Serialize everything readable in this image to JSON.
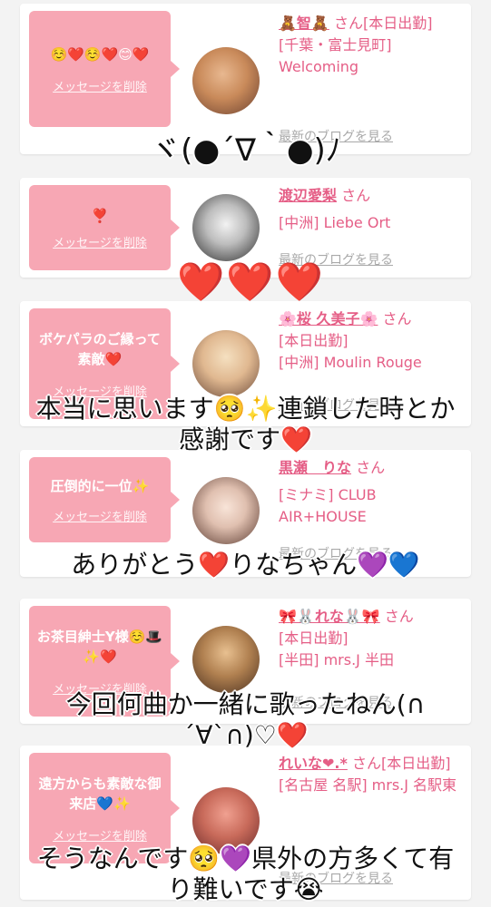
{
  "cards": [
    {
      "message": "☺️❤️☺️❤️😊❤️",
      "delete_label": "メッセージを削除",
      "name": "🧸智🧸",
      "suffix": "さん[本日出勤]",
      "location": "[千葉・富士見町] Welcoming",
      "location2": "",
      "blog_label": "最新のブログを見る",
      "avatar_colors": [
        "#c98a5a",
        "#8a5a3a"
      ]
    },
    {
      "message": "❣️",
      "delete_label": "メッセージを削除",
      "name": "渡辺愛梨",
      "suffix": "さん",
      "location": "[中洲] Liebe Ort",
      "location2": "",
      "blog_label": "最新のブログを見る",
      "avatar_colors": [
        "#d8d8d8",
        "#333333"
      ]
    },
    {
      "message": "ボケパラのご縁って素敵❤️",
      "delete_label": "メッセージを削除",
      "name": "🌸桜 久美子🌸",
      "suffix": "さん",
      "location": "[本日出勤]",
      "location2": "[中洲] Moulin Rouge",
      "blog_label": "最新のブログを見る",
      "avatar_colors": [
        "#e8c9a0",
        "#6b4a3a"
      ]
    },
    {
      "message": "圧倒的に一位✨",
      "delete_label": "メッセージを削除",
      "name": "黒瀬　りな",
      "suffix": "さん",
      "location": "[ミナミ] CLUB AIR+HOUSE",
      "location2": "",
      "blog_label": "最新のブログを見る",
      "avatar_colors": [
        "#f0d8c8",
        "#5a3a30"
      ]
    },
    {
      "message": "お茶目紳士Y様☺️🎩✨❤️",
      "delete_label": "メッセージを削除",
      "name": "🎀🐰れな🐰🎀",
      "suffix": "さん",
      "location": "[本日出勤]",
      "location2": "[半田] mrs.J 半田",
      "blog_label": "最新のブログを見る",
      "avatar_colors": [
        "#b08050",
        "#4a3020"
      ]
    },
    {
      "message": "遠方からも素敵な御来店💙✨",
      "delete_label": "メッセージを削除",
      "name": "れいな❤︎.*",
      "suffix": "さん[本日出勤]",
      "location": "[名古屋 名駅] mrs.J 名駅東",
      "location2": "",
      "blog_label": "最新のブログを見る",
      "avatar_colors": [
        "#c86a5a",
        "#6a2a2a"
      ]
    }
  ],
  "overlays": {
    "kaomoji": "ヾ(●´∇｀●)ﾉ",
    "hearts": "❤️❤️❤️",
    "line1": "本当に思います🥺✨連鎖した時とか\n感謝です❤️",
    "line2": "ありがとう❤️りなちゃん💜💙",
    "line3": "今回何曲か一緒に歌ったねん(∩\n´∀`∩)♡❤️",
    "line4": "そうなんです🥺💜県外の方多くて有\nり難いです😭"
  }
}
